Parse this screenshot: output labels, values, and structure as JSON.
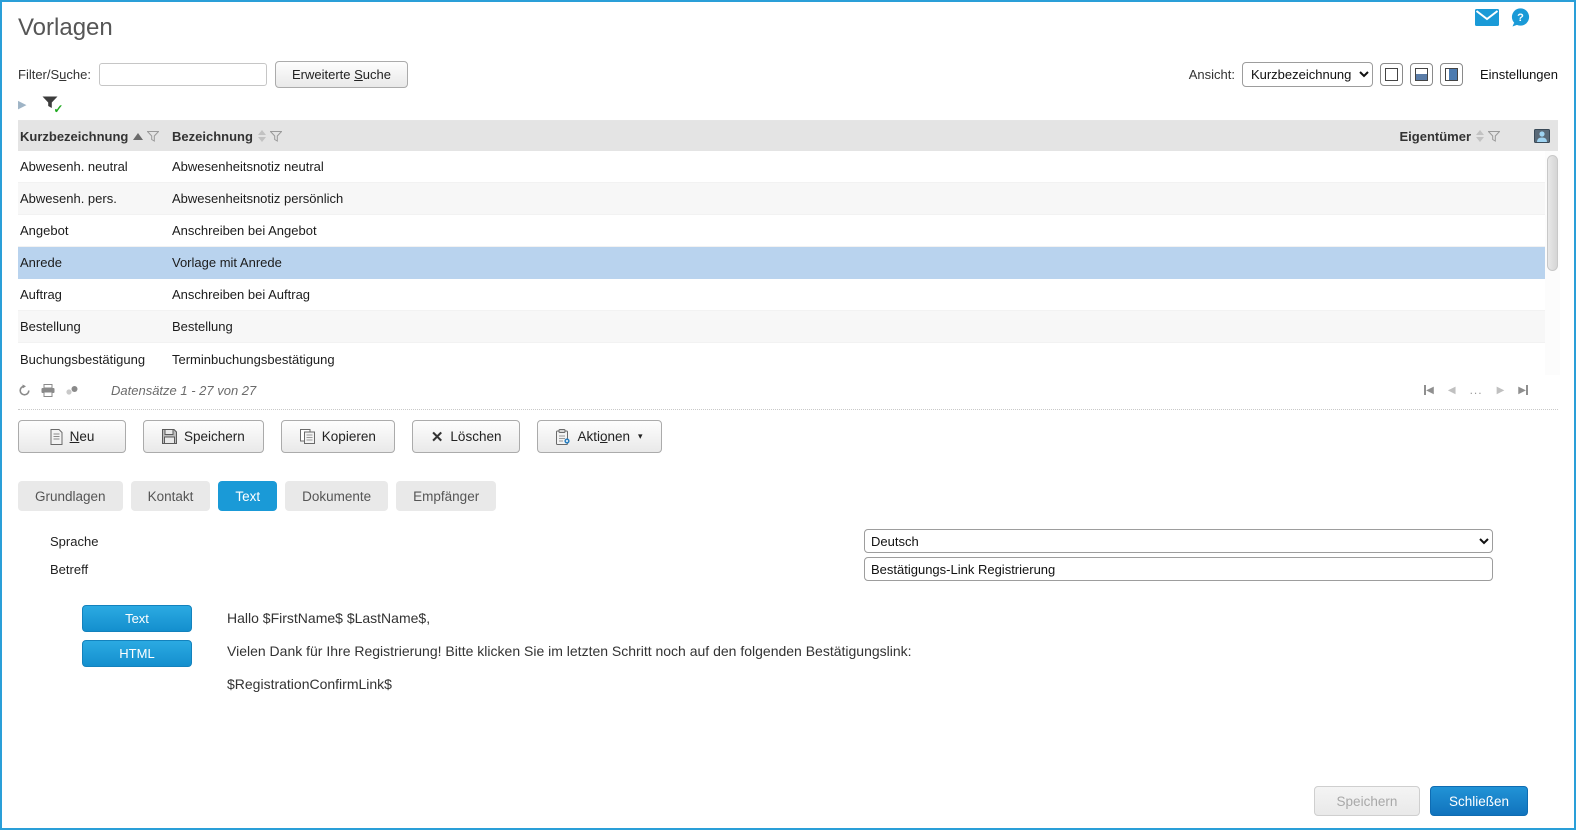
{
  "header": {
    "title": "Vorlagen",
    "icons": {
      "mail": "mail-icon",
      "help": "help-icon"
    }
  },
  "filter": {
    "label_pre": "Filter/S",
    "label_key": "u",
    "label_post": "che:",
    "input_value": "",
    "advanced_pre": "Erweiterte ",
    "advanced_key": "S",
    "advanced_post": "uche"
  },
  "view": {
    "label": "Ansicht:",
    "selected_option": "Kurzbezeichnung",
    "settings_label": "Einstellungen"
  },
  "table": {
    "columns": {
      "kurz": "Kurzbezeichnung",
      "bez": "Bezeichnung",
      "eig": "Eigentümer"
    },
    "rows": [
      {
        "kurz": "Abwesenh. neutral",
        "bez": "Abwesenheitsnotiz neutral"
      },
      {
        "kurz": "Abwesenh. pers.",
        "bez": "Abwesenheitsnotiz persönlich"
      },
      {
        "kurz": "Angebot",
        "bez": "Anschreiben bei Angebot"
      },
      {
        "kurz": "Anrede",
        "bez": "Vorlage mit Anrede"
      },
      {
        "kurz": "Auftrag",
        "bez": "Anschreiben bei Auftrag"
      },
      {
        "kurz": "Bestellung",
        "bez": "Bestellung"
      },
      {
        "kurz": "Buchungsbestätigung",
        "bez": "Terminbuchungsbestätigung"
      }
    ],
    "selected_row_index": 3,
    "footer": {
      "records": "Datensätze 1 - 27 von 27",
      "ellipsis": "..."
    }
  },
  "actions": {
    "neu_key": "N",
    "neu_post": "eu",
    "speichern": "Speichern",
    "kopieren": "Kopieren",
    "loeschen": "Löschen",
    "aktionen_pre": "Akti",
    "aktionen_key": "o",
    "aktionen_post": "nen",
    "caret": "▾"
  },
  "tabs": [
    {
      "label": "Grundlagen"
    },
    {
      "label": "Kontakt"
    },
    {
      "label": "Text",
      "active": true
    },
    {
      "label": "Dokumente"
    },
    {
      "label": "Empfänger"
    }
  ],
  "form": {
    "sprache_label": "Sprache",
    "sprache_value": "Deutsch",
    "betreff_label": "Betreff",
    "betreff_value": "Bestätigungs-Link Registrierung"
  },
  "editor": {
    "text_button": "Text",
    "html_button": "HTML",
    "lines": [
      "Hallo $FirstName$ $LastName$,",
      "Vielen Dank für Ihre Registrierung! Bitte klicken Sie im letzten Schritt noch auf den folgenden Bestätigungslink:",
      "$RegistrationConfirmLink$"
    ]
  },
  "bottom": {
    "speichern": "Speichern",
    "schliessen": "Schließen"
  },
  "colors": {
    "accent_blue": "#1a9ad7",
    "window_border": "#2a9fd8",
    "selected_row": "#b9d3ee",
    "table_header_bg": "#e4e4e4",
    "primary_button": "#1173bd",
    "check_green": "#22aa22"
  }
}
